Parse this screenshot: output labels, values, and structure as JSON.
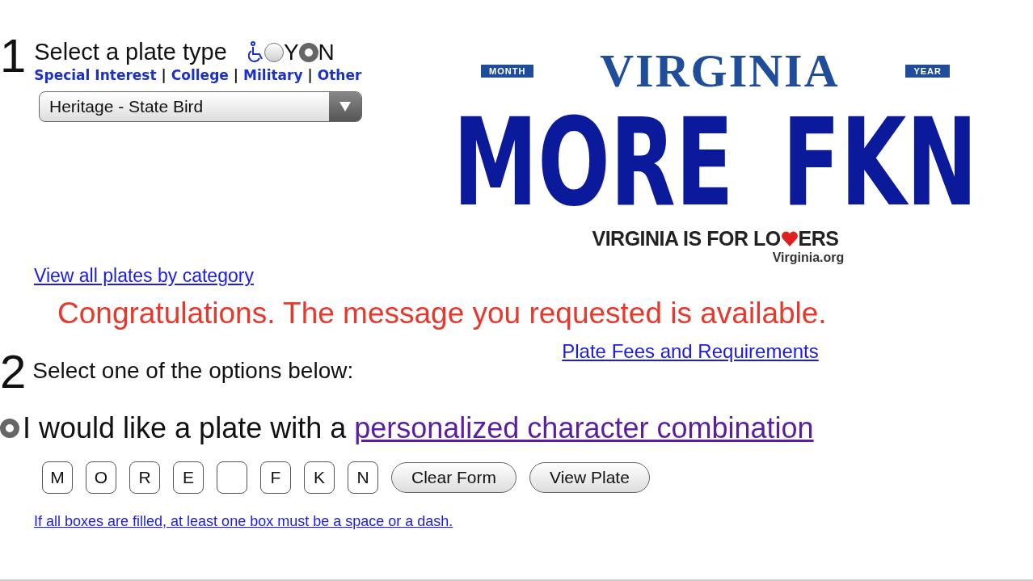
{
  "step1": {
    "number": "1",
    "title": "Select a plate type",
    "accessible_options": [
      {
        "label": "Y",
        "selected": false
      },
      {
        "label": "N",
        "selected": true
      }
    ],
    "categories": [
      "Special Interest",
      "College",
      "Military",
      "Other"
    ],
    "separator": "|",
    "plate_type": {
      "value": "Heritage - State Bird"
    },
    "view_all_link": "View all plates by category"
  },
  "plate": {
    "month": "MONTH",
    "state": "VIRGINIA",
    "year": "YEAR",
    "text": "MORE FKN",
    "slogan_before": "VIRGINIA IS FOR LO",
    "slogan_after": "ERS",
    "website": "Virginia.org"
  },
  "message": "Congratulations. The message you requested is available.",
  "step2": {
    "number": "2",
    "title": "Select one of the options below:",
    "fees_link": "Plate Fees and Requirements",
    "option": {
      "selected": true,
      "text": "I would like a plate with a ",
      "link": "personalized character combination"
    },
    "characters": [
      {
        "kind": "letter",
        "value": "M"
      },
      {
        "kind": "letter",
        "value": "O"
      },
      {
        "kind": "letter",
        "value": "R"
      },
      {
        "kind": "letter",
        "value": "E"
      },
      {
        "kind": "blank"
      },
      {
        "kind": "letter",
        "value": "F"
      },
      {
        "kind": "letter",
        "value": "K"
      },
      {
        "kind": "letter",
        "value": "N"
      }
    ],
    "buttons": [
      "Clear Form",
      "View Plate"
    ],
    "note": "If all boxes are filled, at least one box must be a space or a dash."
  }
}
